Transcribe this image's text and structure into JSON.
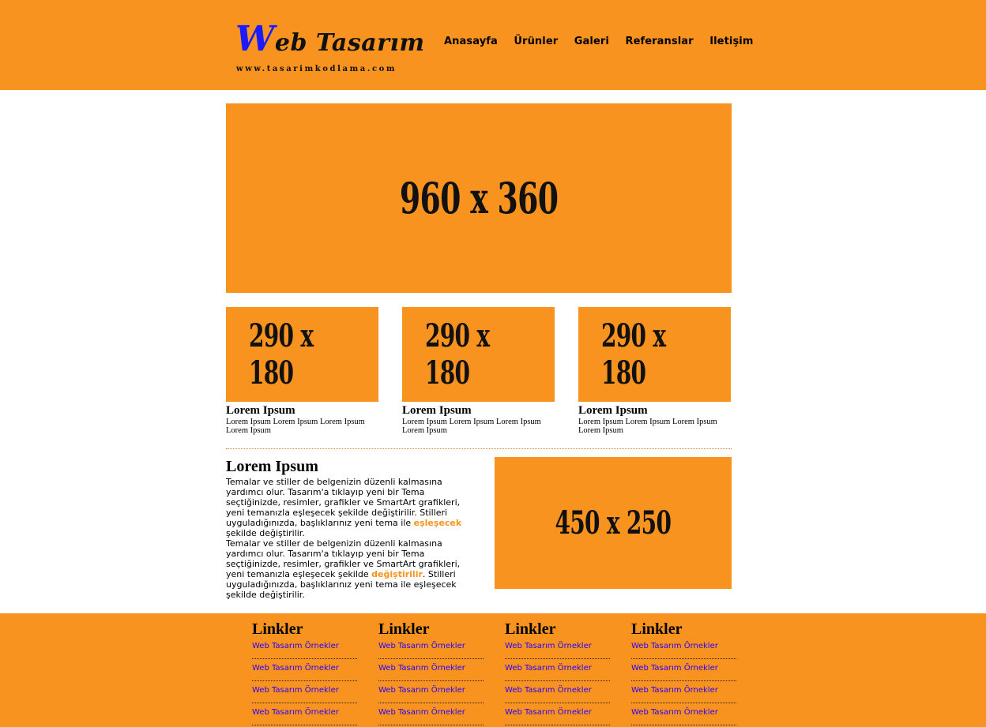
{
  "header": {
    "logo_w": "W",
    "logo_rest": "eb Tasarım",
    "logo_url": "www.tasarimkodlama.com",
    "nav": [
      "Anasayfa",
      "Ürünler",
      "Galeri",
      "Referanslar",
      "Iletişim"
    ]
  },
  "hero": {
    "label": "960 x 360"
  },
  "cards": [
    {
      "image_label": "290 x 180",
      "title": "Lorem Ipsum",
      "text": "Lorem Ipsum Lorem Ipsum Lorem Ipsum Lorem Ipsum"
    },
    {
      "image_label": "290 x 180",
      "title": "Lorem Ipsum",
      "text": "Lorem Ipsum Lorem Ipsum Lorem Ipsum Lorem Ipsum"
    },
    {
      "image_label": "290 x 180",
      "title": "Lorem Ipsum",
      "text": "Lorem Ipsum Lorem Ipsum Lorem Ipsum Lorem Ipsum"
    }
  ],
  "section": {
    "title": "Lorem Ipsum",
    "p1_before": "Temalar ve stiller de belgenizin düzenli kalmasına yardımcı olur. Tasarım'a tıklayıp yeni bir Tema seçtiğinizde, resimler, grafikler ve SmartArt grafikleri, yeni temanızla eşleşecek şekilde değiştirilir. Stilleri uyguladığınızda, başlıklarınız yeni tema ile ",
    "p1_highlight": "eşleşecek",
    "p1_after": " şekilde değiştirilir.",
    "p2_before": "Temalar ve stiller de belgenizin düzenli kalmasına yardımcı olur. Tasarım'a tıklayıp yeni bir Tema seçtiğinizde, resimler, grafikler ve SmartArt grafikleri, yeni temanızla eşleşecek şekilde ",
    "p2_highlight": "değiştirilir",
    "p2_after": ". Stilleri uyguladığınızda, başlıklarınız yeni tema ile eşleşecek şekilde değiştirilir.",
    "image_label": "450 x 250"
  },
  "footer": {
    "columns": [
      {
        "title": "Linkler",
        "links": [
          "Web Tasarım Örnekler",
          "Web Tasarım Örnekler",
          "Web Tasarım Örnekler",
          "Web Tasarım Örnekler"
        ]
      },
      {
        "title": "Linkler",
        "links": [
          "Web Tasarım Örnekler",
          "Web Tasarım Örnekler",
          "Web Tasarım Örnekler",
          "Web Tasarım Örnekler"
        ]
      },
      {
        "title": "Linkler",
        "links": [
          "Web Tasarım Örnekler",
          "Web Tasarım Örnekler",
          "Web Tasarım Örnekler",
          "Web Tasarım Örnekler"
        ]
      },
      {
        "title": "Linkler",
        "links": [
          "Web Tasarım Örnekler",
          "Web Tasarım Örnekler",
          "Web Tasarım Örnekler",
          "Web Tasarım Örnekler"
        ]
      }
    ]
  },
  "colors": {
    "accent": "#f7931e",
    "logo_blue": "#1a1aff",
    "link_blue": "#2a00ff"
  }
}
